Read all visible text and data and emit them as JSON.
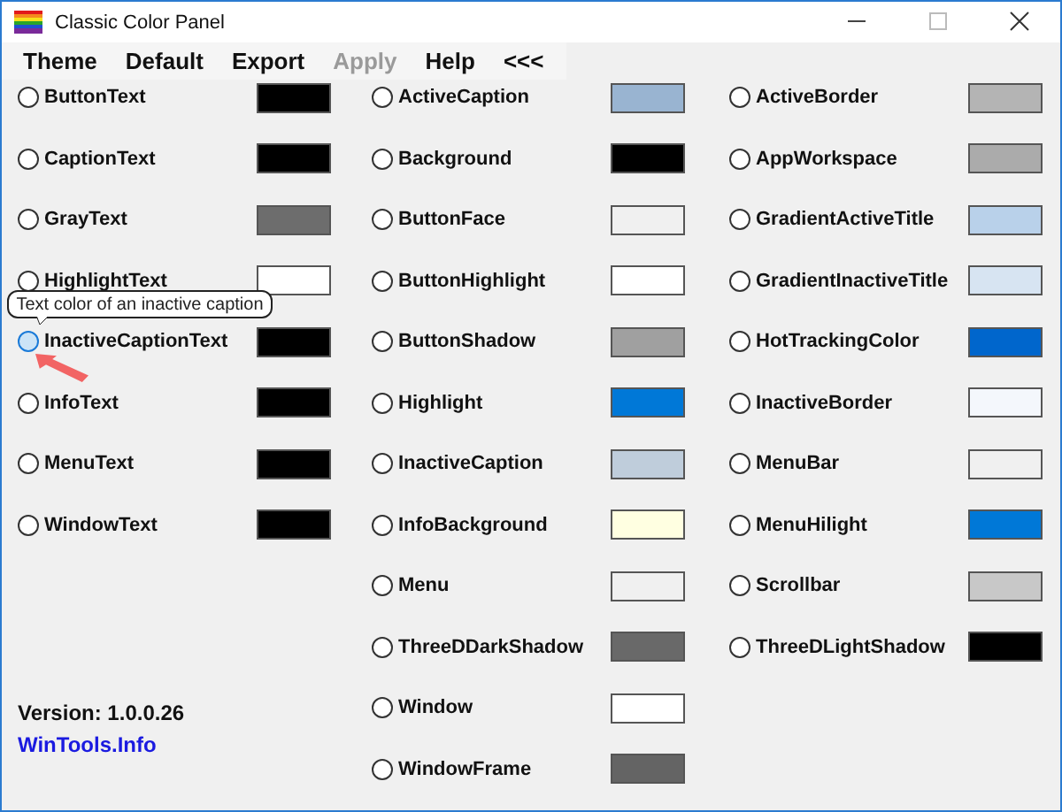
{
  "window": {
    "title": "Classic Color Panel"
  },
  "menu": [
    {
      "label": "Theme",
      "disabled": false
    },
    {
      "label": "Default",
      "disabled": false
    },
    {
      "label": "Export",
      "disabled": false
    },
    {
      "label": "Apply",
      "disabled": true
    },
    {
      "label": "Help",
      "disabled": false
    },
    {
      "label": "<<<",
      "disabled": false
    }
  ],
  "columns": [
    [
      {
        "name": "ButtonText",
        "selected": false,
        "hovered": false,
        "color": "#000000"
      },
      {
        "name": "CaptionText",
        "selected": false,
        "hovered": false,
        "color": "#000000"
      },
      {
        "name": "GrayText",
        "selected": false,
        "hovered": false,
        "color": "#6d6d6d"
      },
      {
        "name": "HighlightText",
        "selected": false,
        "hovered": false,
        "color": "#ffffff"
      },
      {
        "name": "InactiveCaptionText",
        "selected": false,
        "hovered": true,
        "color": "#000000"
      },
      {
        "name": "InfoText",
        "selected": false,
        "hovered": false,
        "color": "#000000"
      },
      {
        "name": "MenuText",
        "selected": false,
        "hovered": false,
        "color": "#000000"
      },
      {
        "name": "WindowText",
        "selected": false,
        "hovered": false,
        "color": "#000000"
      }
    ],
    [
      {
        "name": "ActiveCaption",
        "selected": false,
        "hovered": false,
        "color": "#99b4d1"
      },
      {
        "name": "Background",
        "selected": false,
        "hovered": false,
        "color": "#000000"
      },
      {
        "name": "ButtonFace",
        "selected": false,
        "hovered": false,
        "color": "#f0f0f0"
      },
      {
        "name": "ButtonHighlight",
        "selected": false,
        "hovered": false,
        "color": "#ffffff"
      },
      {
        "name": "ButtonShadow",
        "selected": false,
        "hovered": false,
        "color": "#a0a0a0"
      },
      {
        "name": "Highlight",
        "selected": false,
        "hovered": false,
        "color": "#0078d7"
      },
      {
        "name": "InactiveCaption",
        "selected": false,
        "hovered": false,
        "color": "#bfcddb"
      },
      {
        "name": "InfoBackground",
        "selected": false,
        "hovered": false,
        "color": "#ffffe1"
      },
      {
        "name": "Menu",
        "selected": false,
        "hovered": false,
        "color": "#f0f0f0"
      },
      {
        "name": "ThreeDDarkShadow",
        "selected": false,
        "hovered": false,
        "color": "#696969"
      },
      {
        "name": "Window",
        "selected": false,
        "hovered": false,
        "color": "#ffffff"
      },
      {
        "name": "WindowFrame",
        "selected": false,
        "hovered": false,
        "color": "#646464"
      }
    ],
    [
      {
        "name": "ActiveBorder",
        "selected": false,
        "hovered": false,
        "color": "#b4b4b4"
      },
      {
        "name": "AppWorkspace",
        "selected": false,
        "hovered": false,
        "color": "#ababab"
      },
      {
        "name": "GradientActiveTitle",
        "selected": false,
        "hovered": false,
        "color": "#b9d1ea"
      },
      {
        "name": "GradientInactiveTitle",
        "selected": false,
        "hovered": false,
        "color": "#d7e4f2"
      },
      {
        "name": "HotTrackingColor",
        "selected": false,
        "hovered": false,
        "color": "#0066cc"
      },
      {
        "name": "InactiveBorder",
        "selected": false,
        "hovered": false,
        "color": "#f4f7fc"
      },
      {
        "name": "MenuBar",
        "selected": false,
        "hovered": false,
        "color": "#f0f0f0"
      },
      {
        "name": "MenuHilight",
        "selected": false,
        "hovered": false,
        "color": "#0078d7"
      },
      {
        "name": "Scrollbar",
        "selected": false,
        "hovered": false,
        "color": "#c8c8c8"
      },
      {
        "name": "ThreeDLightShadow",
        "selected": false,
        "hovered": false,
        "color": "#000000"
      }
    ]
  ],
  "tooltip": "Text color of an inactive caption",
  "version": "Version: 1.0.0.26",
  "link": "WinTools.Info"
}
